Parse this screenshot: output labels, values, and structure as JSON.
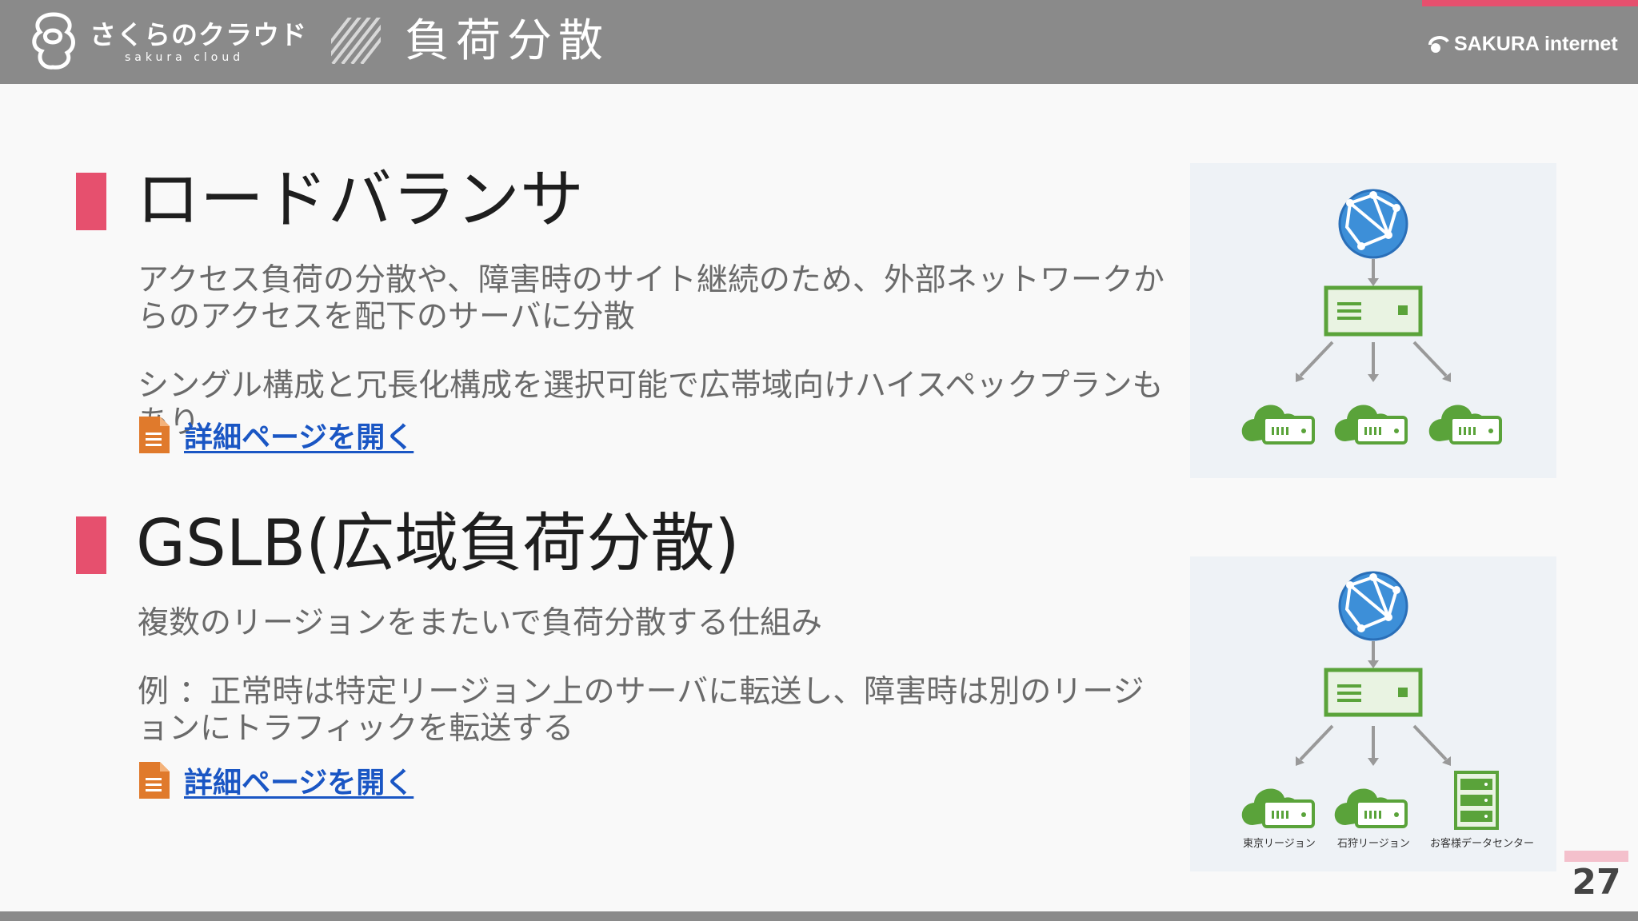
{
  "header": {
    "logo_main": "さくらのクラウド",
    "logo_sub": "sakura cloud",
    "title": "負荷分散",
    "corp_logo": "SAKURA internet"
  },
  "sections": [
    {
      "title": "ロードバランサ",
      "paragraphs": [
        "アクセス負荷の分散や、障害時のサイト継続のため、外部ネットワークからのアクセスを配下のサーバに分散",
        "シングル構成と冗長化構成を選択可能で広帯域向けハイスペックプランもあり"
      ],
      "link": "詳細ページを開く"
    },
    {
      "title": "GSLB(広域負荷分散)",
      "paragraphs": [
        "複数のリージョンをまたいで負荷分散する仕組み",
        "例 ：正常時は特定リージョン上のサーバに転送し、障害時は別のリージョンにトラフィックを転送する"
      ],
      "link": "詳細ページを開く"
    }
  ],
  "diagram2_labels": [
    "東京リージョン",
    "石狩リージョン",
    "お客様データセンター"
  ],
  "page_number": "27",
  "colors": {
    "accent": "#e6506e",
    "header_bg": "#8a8a8a",
    "link": "#1a56c4",
    "diagram_green": "#5aa33a",
    "globe_blue": "#3d8fd8"
  },
  "icons": [
    "sakura-logo-icon",
    "globe-icon",
    "load-balancer-icon",
    "cloud-server-icon",
    "rack-server-icon",
    "document-icon"
  ]
}
